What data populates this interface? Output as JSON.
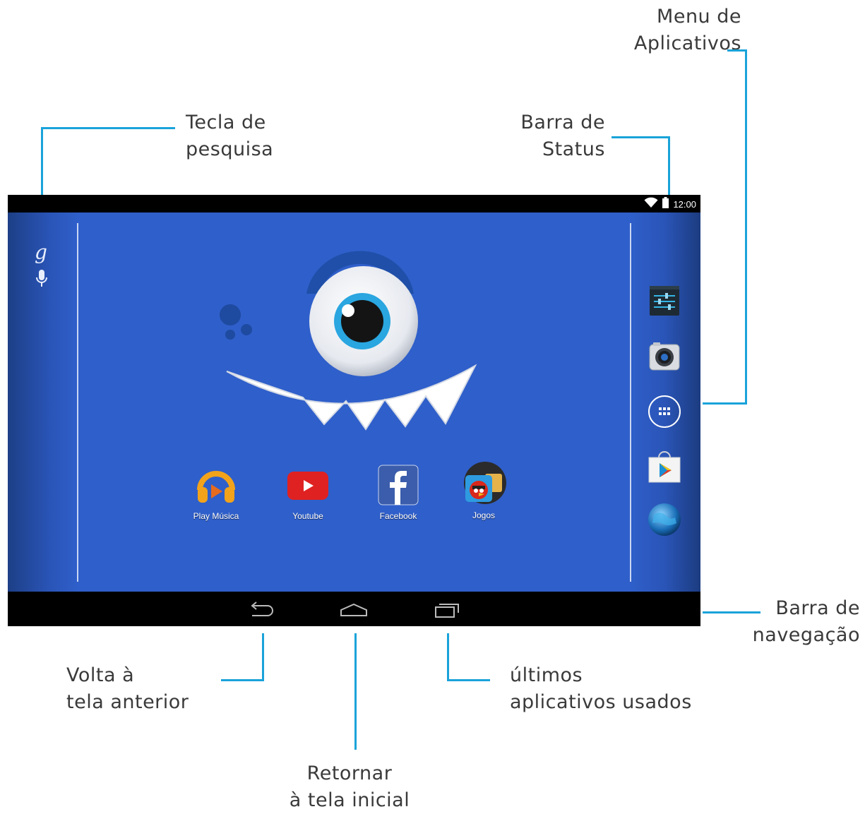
{
  "callouts": {
    "app_menu": [
      "Menu de",
      "Aplicativos"
    ],
    "search_key": [
      "Tecla de",
      "pesquisa"
    ],
    "status_bar": [
      "Barra de",
      "Status"
    ],
    "nav_bar": [
      "Barra de",
      "navegação"
    ],
    "back": [
      "Volta à",
      "tela anterior"
    ],
    "recent": [
      "últimos",
      "aplicativos usados"
    ],
    "home": [
      "Retornar",
      " à tela inicial"
    ]
  },
  "status": {
    "time": "12:00"
  },
  "search": {
    "google_glyph": "g"
  },
  "apps": [
    {
      "label": "Play Música",
      "icon": "headphones-icon"
    },
    {
      "label": "Youtube",
      "icon": "youtube-icon"
    },
    {
      "label": "Facebook",
      "icon": "facebook-icon"
    },
    {
      "label": "Jogos",
      "icon": "angry-birds-icon"
    }
  ],
  "dock": [
    "settings-icon",
    "camera-icon",
    "app-drawer-icon",
    "play-store-icon",
    "browser-globe-icon"
  ],
  "colors": {
    "accent_line": "#1aa3d9",
    "wallpaper": "#2f5fca",
    "bars": "#000000"
  }
}
